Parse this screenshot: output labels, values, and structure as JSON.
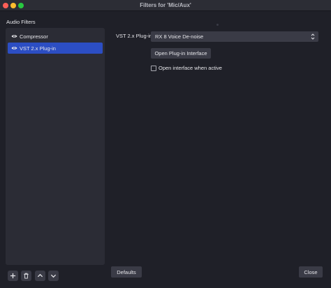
{
  "window": {
    "title": "Filters for 'Mic/Aux'"
  },
  "sidebar": {
    "label": "Audio Filters",
    "items": [
      {
        "label": "Compressor",
        "selected": false,
        "icon": "eye-icon"
      },
      {
        "label": "VST 2.x Plug-in",
        "selected": true,
        "icon": "eye-icon"
      }
    ]
  },
  "plugin": {
    "label": "VST 2.x Plug-in",
    "selected_value": "RX 8 Voice De-noise",
    "open_interface_label": "Open Plug-in Interface",
    "open_when_active_label": "Open interface when active",
    "open_when_active_checked": false
  },
  "toolbar": {
    "add_icon": "plus-icon",
    "remove_icon": "trash-icon",
    "move_up_icon": "chevron-up-icon",
    "move_down_icon": "chevron-down-icon"
  },
  "footer": {
    "defaults_label": "Defaults",
    "close_label": "Close"
  },
  "colors": {
    "accent": "#2c4ec3",
    "background": "#1f2028",
    "panel": "#2b2c35"
  }
}
